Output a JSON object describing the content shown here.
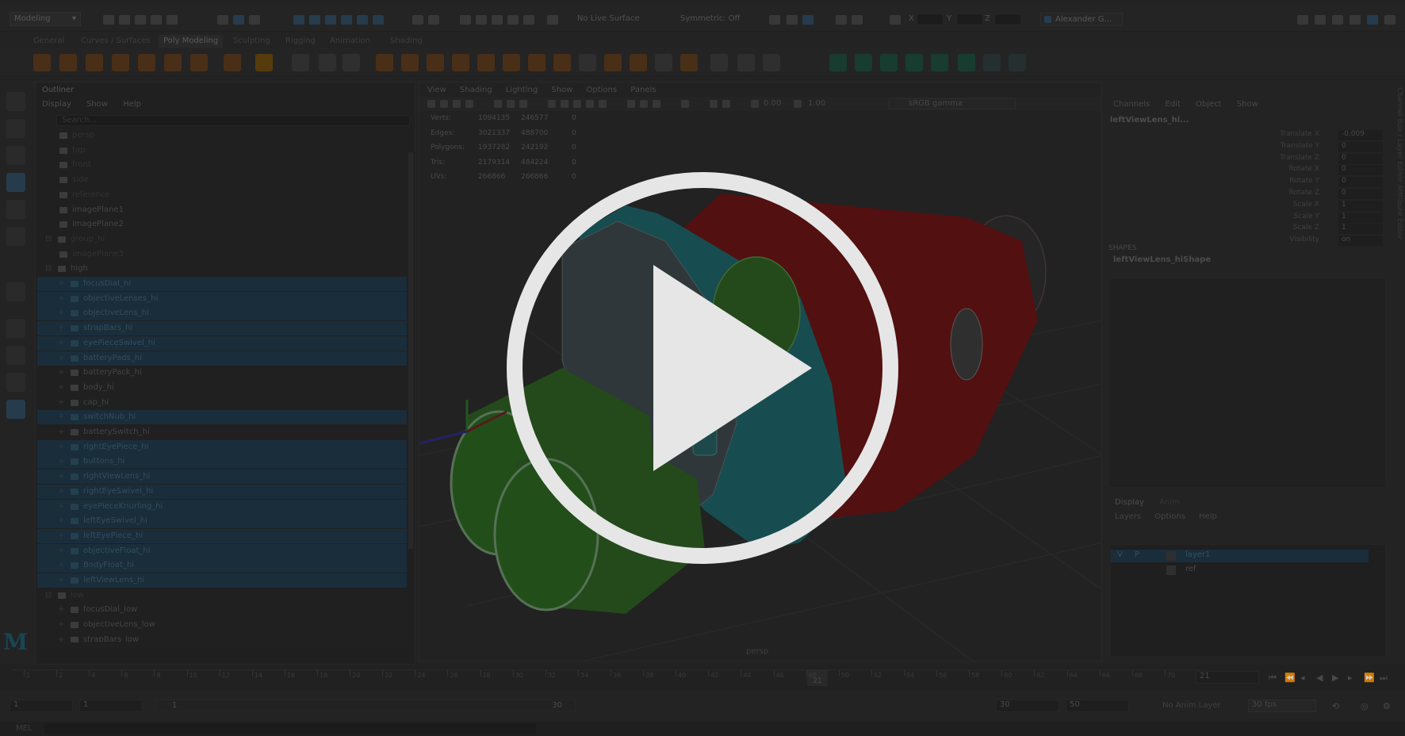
{
  "topbar": {
    "mode": "Modeling",
    "live_surface": "No Live Surface",
    "symmetry": "Symmetric: Off",
    "xyz": [
      "X",
      "Y",
      "Z"
    ],
    "user": "Alexander G..."
  },
  "shelf": {
    "tabs": [
      "General",
      "Curves / Surfaces",
      "Poly Modeling",
      "Sculpting",
      "Rigging",
      "Animation",
      "Shading"
    ],
    "active_tab": "Poly Modeling"
  },
  "outliner": {
    "title": "Outliner",
    "menu": [
      "Display",
      "Show",
      "Help"
    ],
    "search_placeholder": "Search...",
    "items": [
      {
        "label": "persp",
        "indent": 0,
        "state": "dim",
        "icon": "camera-icon"
      },
      {
        "label": "top",
        "indent": 0,
        "state": "dim",
        "icon": "camera-icon"
      },
      {
        "label": "front",
        "indent": 0,
        "state": "dim",
        "icon": "camera-icon"
      },
      {
        "label": "side",
        "indent": 0,
        "state": "dim",
        "icon": "camera-icon"
      },
      {
        "label": "reference",
        "indent": 0,
        "state": "dim",
        "icon": "mesh-icon"
      },
      {
        "label": "imagePlane1",
        "indent": 0,
        "state": "normal",
        "icon": "image-plane-icon"
      },
      {
        "label": "imagePlane2",
        "indent": 0,
        "state": "normal",
        "icon": "image-plane-icon"
      },
      {
        "label": "group_hi",
        "indent": -1,
        "state": "dim",
        "icon": "group-icon"
      },
      {
        "label": "imagePlane3",
        "indent": 0,
        "state": "dim",
        "icon": "image-plane-icon"
      },
      {
        "label": "high",
        "indent": -1,
        "state": "normal",
        "icon": "group-icon"
      },
      {
        "label": "focusDial_hi",
        "indent": 1,
        "state": "sel",
        "icon": "mesh-icon"
      },
      {
        "label": "objectiveLenses_hi",
        "indent": 1,
        "state": "sel",
        "icon": "mesh-icon"
      },
      {
        "label": "objectiveLens_hi",
        "indent": 1,
        "state": "sel",
        "icon": "mesh-icon"
      },
      {
        "label": "strapBars_hi",
        "indent": 1,
        "state": "sel",
        "icon": "mesh-icon"
      },
      {
        "label": "eyePieceSwivel_hi",
        "indent": 1,
        "state": "sel",
        "icon": "mesh-icon"
      },
      {
        "label": "batteryPads_hi",
        "indent": 1,
        "state": "sel",
        "icon": "mesh-icon"
      },
      {
        "label": "batteryPack_hi",
        "indent": 1,
        "state": "normal",
        "icon": "mesh-icon"
      },
      {
        "label": "body_hi",
        "indent": 1,
        "state": "normal",
        "icon": "mesh-icon"
      },
      {
        "label": "cap_hi",
        "indent": 1,
        "state": "normal",
        "icon": "mesh-icon"
      },
      {
        "label": "switchNub_hi",
        "indent": 1,
        "state": "sel",
        "icon": "mesh-icon"
      },
      {
        "label": "batterySwitch_hi",
        "indent": 1,
        "state": "normal",
        "icon": "mesh-icon"
      },
      {
        "label": "rightEyePiece_hi",
        "indent": 1,
        "state": "sel",
        "icon": "mesh-icon"
      },
      {
        "label": "buttons_hi",
        "indent": 1,
        "state": "sel",
        "icon": "mesh-icon"
      },
      {
        "label": "rightViewLens_hi",
        "indent": 1,
        "state": "sel",
        "icon": "mesh-icon"
      },
      {
        "label": "rightEyeSwivel_hi",
        "indent": 1,
        "state": "sel",
        "icon": "mesh-icon"
      },
      {
        "label": "eyePieceKnurling_hi",
        "indent": 1,
        "state": "sel",
        "icon": "mesh-icon"
      },
      {
        "label": "leftEyeSwivel_hi",
        "indent": 1,
        "state": "sel",
        "icon": "mesh-icon"
      },
      {
        "label": "leftEyePiece_hi",
        "indent": 1,
        "state": "sel",
        "icon": "mesh-icon"
      },
      {
        "label": "objectiveFloat_hi",
        "indent": 1,
        "state": "sel",
        "icon": "mesh-icon"
      },
      {
        "label": "BodyFloat_hi",
        "indent": 1,
        "state": "sel",
        "icon": "mesh-icon"
      },
      {
        "label": "leftViewLens_hi",
        "indent": 1,
        "state": "sel",
        "icon": "mesh-icon"
      },
      {
        "label": "low",
        "indent": -1,
        "state": "dim",
        "icon": "group-icon"
      },
      {
        "label": "focusDial_low",
        "indent": 1,
        "state": "normal",
        "icon": "mesh-icon"
      },
      {
        "label": "objectiveLens_low",
        "indent": 1,
        "state": "normal",
        "icon": "mesh-icon"
      },
      {
        "label": "strapBars_low",
        "indent": 1,
        "state": "normal",
        "icon": "mesh-icon"
      }
    ]
  },
  "viewport": {
    "menu": [
      "View",
      "Shading",
      "Lighting",
      "Show",
      "Options",
      "Panels"
    ],
    "field1": "0.00",
    "field2": "1.00",
    "color_space": "sRGB gamma",
    "stats": [
      {
        "label": "Verts:",
        "a": "1094135",
        "b": "246577",
        "c": "0"
      },
      {
        "label": "Edges:",
        "a": "3021337",
        "b": "488700",
        "c": "0"
      },
      {
        "label": "Polygons:",
        "a": "1937282",
        "b": "242192",
        "c": "0"
      },
      {
        "label": "Tris:",
        "a": "2179314",
        "b": "484224",
        "c": "0"
      },
      {
        "label": "UVs:",
        "a": "266866",
        "b": "266866",
        "c": "0"
      }
    ],
    "camera": "persp"
  },
  "channel_box": {
    "menu": [
      "Channels",
      "Edit",
      "Object",
      "Show"
    ],
    "node": "leftViewLens_hi...",
    "attributes": [
      {
        "label": "Translate X",
        "value": "-0.009"
      },
      {
        "label": "Translate Y",
        "value": "0"
      },
      {
        "label": "Translate Z",
        "value": "0"
      },
      {
        "label": "Rotate X",
        "value": "0"
      },
      {
        "label": "Rotate Y",
        "value": "0"
      },
      {
        "label": "Rotate Z",
        "value": "0"
      },
      {
        "label": "Scale X",
        "value": "1"
      },
      {
        "label": "Scale Y",
        "value": "1"
      },
      {
        "label": "Scale Z",
        "value": "1"
      },
      {
        "label": "Visibility",
        "value": "on"
      }
    ],
    "shapes_header": "SHAPES",
    "shape_node": "leftViewLens_hiShape",
    "side_tabs": "Channel Box / Layer Editor     Attribute Editor"
  },
  "layers": {
    "tabs": [
      "Display",
      "Anim"
    ],
    "menu": [
      "Layers",
      "Options",
      "Help"
    ],
    "rows": [
      {
        "v": "V",
        "p": "P",
        "name": "layer1",
        "selected": true
      },
      {
        "v": "",
        "p": "",
        "name": "ref",
        "selected": false
      }
    ]
  },
  "timeline": {
    "ticks": [
      "1",
      "2",
      "4",
      "6",
      "8",
      "10",
      "12",
      "14",
      "16",
      "18",
      "20",
      "22",
      "24",
      "26",
      "28",
      "30",
      "32",
      "34",
      "36",
      "38",
      "40",
      "42",
      "44",
      "46",
      "48",
      "50",
      "52",
      "54",
      "56",
      "58",
      "60",
      "62",
      "64",
      "66",
      "68",
      "70"
    ],
    "current": "21",
    "current_frame": "21"
  },
  "range": {
    "start": "1",
    "start_inner": "1",
    "slider_start": "1",
    "slider_end": "30",
    "end_inner": "30",
    "end": "50",
    "anim_layer": "No Anim Layer",
    "fps": "30 fps"
  },
  "cmdline": {
    "label": "MEL"
  },
  "colors": {
    "selection": "#203848",
    "body_red": "#7a1414",
    "teal": "#1f6b6e",
    "lens_green": "#2d7a24",
    "play_white": "#e6e6e6"
  }
}
